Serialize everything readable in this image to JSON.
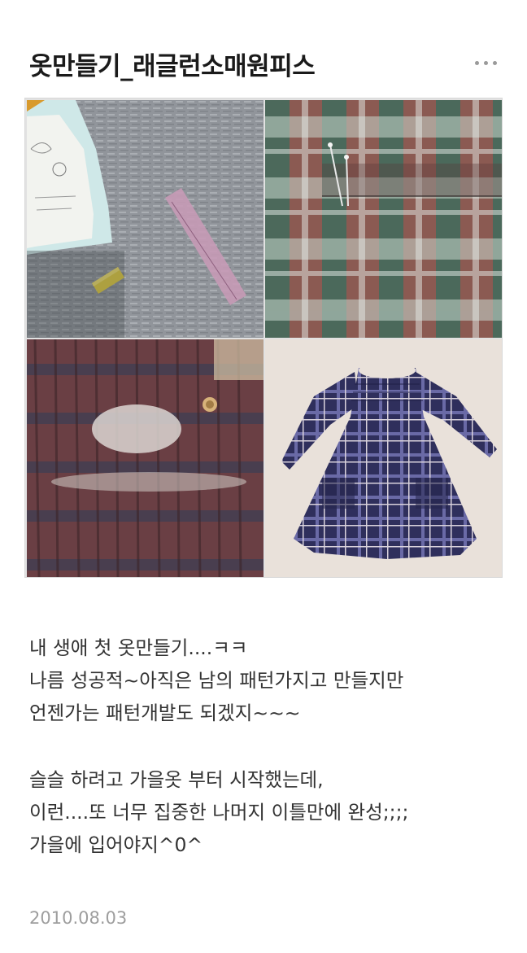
{
  "post": {
    "title": "옷만들기_래글런소매원피스",
    "more_icon": "more-horizontal-icon",
    "paragraph1": [
      "내 생애 첫 옷만들기....ㅋㅋ",
      "나름 성공적~아직은 남의 패턴가지고 만들지만",
      "언젠가는 패턴개발도 되겠지~~~"
    ],
    "paragraph2": [
      "슬슬 하려고 가을옷 부터 시작했는데,",
      "이런....또 너무 집중한 나머지 이틀만에 완성;;;;",
      "가을에 입어야지^0^"
    ],
    "date": "2010.08.03"
  },
  "colors": {
    "title": "#1a1a1a",
    "body_text": "#333333",
    "date": "#9e9e9e",
    "more_dots": "#9a9a9a"
  }
}
